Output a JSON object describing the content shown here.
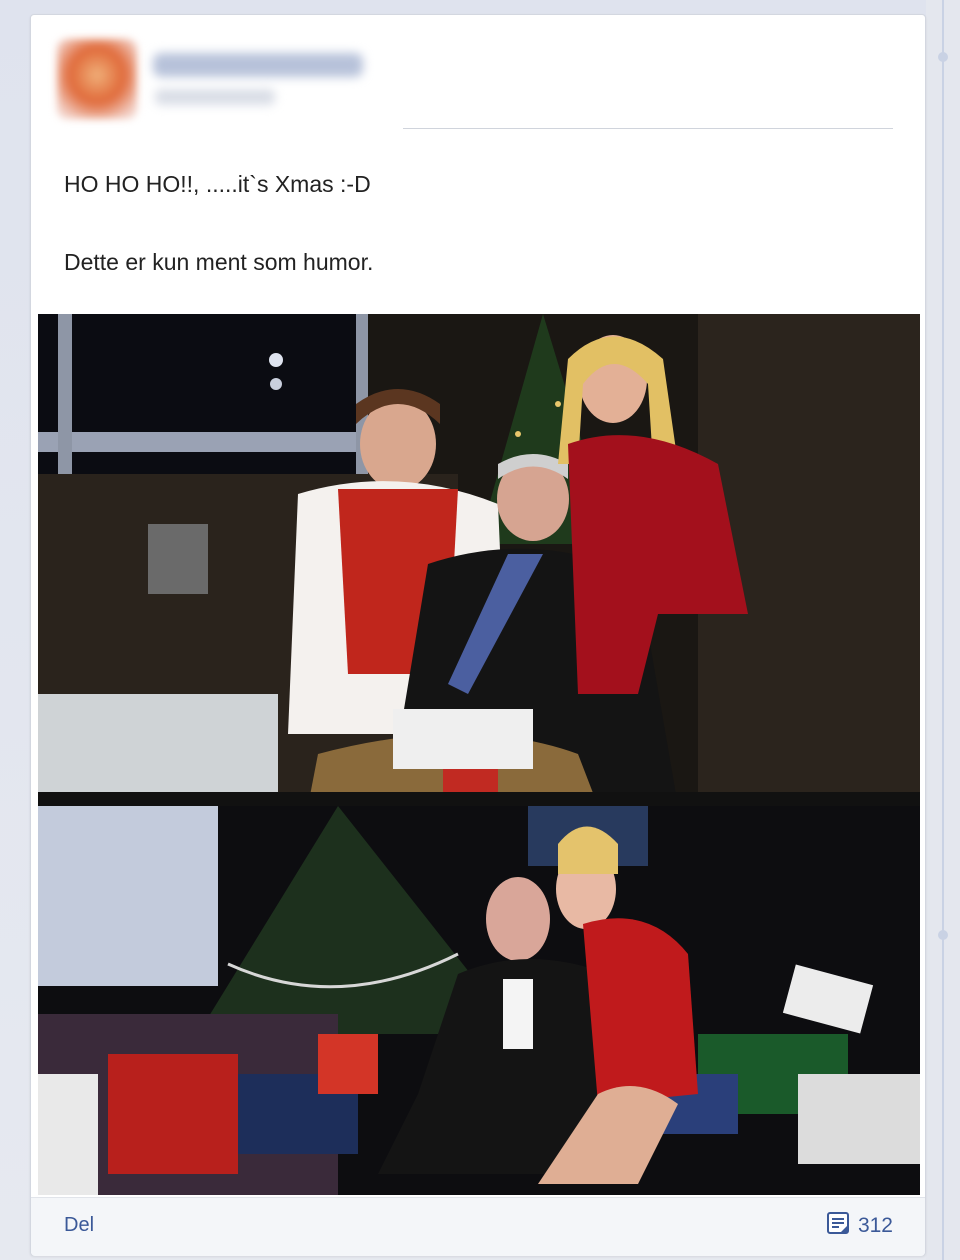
{
  "post": {
    "line1": "HO HO HO!!, .....it`s Xmas :-D",
    "line2": "Dette er kun ment som humor.",
    "photo_alt": "",
    "author_blurred": true
  },
  "footer": {
    "share_label": "Del",
    "comment_count": "312",
    "comment_icon": "comment-icon"
  },
  "colors": {
    "link": "#3b5998",
    "text": "#222222",
    "background": "#e9ebee"
  }
}
